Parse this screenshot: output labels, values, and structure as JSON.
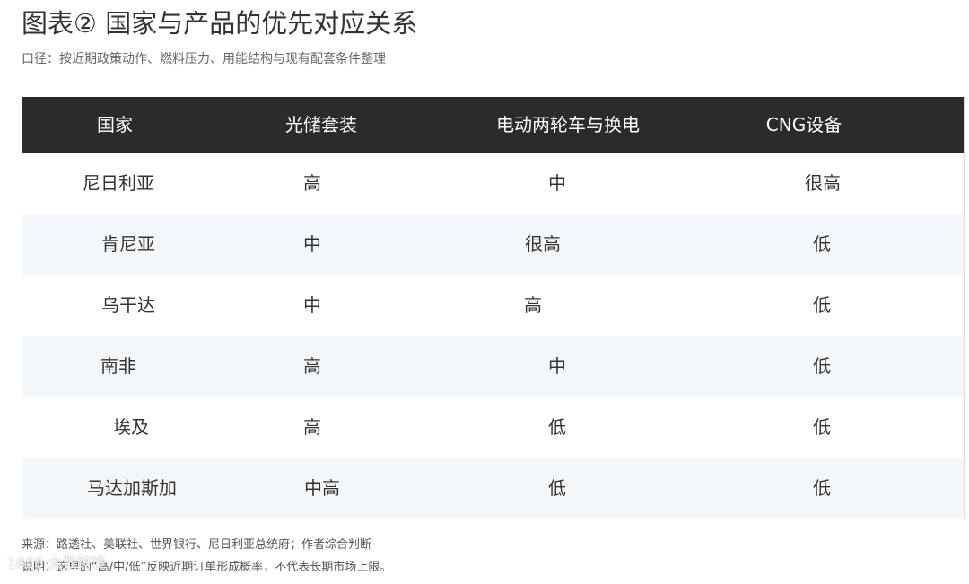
{
  "title": "图表② 国家与产品的优先对应关系",
  "subtitle": "口径：按近期政策动作、燃料压力、用能结构与现有配套条件整理",
  "table": {
    "headers": [
      "国家",
      "光储套装",
      "电动两轮车与换电",
      "CNG设备"
    ],
    "rows": [
      [
        "尼日利亚",
        "高",
        "中",
        "很高"
      ],
      [
        "肯尼亚",
        "中",
        "很高",
        "低"
      ],
      [
        "乌干达",
        "中",
        "高",
        "低"
      ],
      [
        "南非",
        "高",
        "中",
        "低"
      ],
      [
        "埃及",
        "高",
        "低",
        "低"
      ],
      [
        "马达加斯加",
        "中高",
        "低",
        "低"
      ]
    ]
  },
  "footer": {
    "source": "来源：路透社、美联社、世界银行、尼日利亚总统府；作者综合判断",
    "note": "说明：这里的“高/中/低”反映近期订单形成概率，不代表长期市场上限。"
  },
  "watermark": "1688 大数跨境",
  "colors": {
    "header_bg": "#2b2b2b",
    "header_text": "#ffffff",
    "row_alt_bg": "#f4f7fa",
    "text": "#333333"
  }
}
